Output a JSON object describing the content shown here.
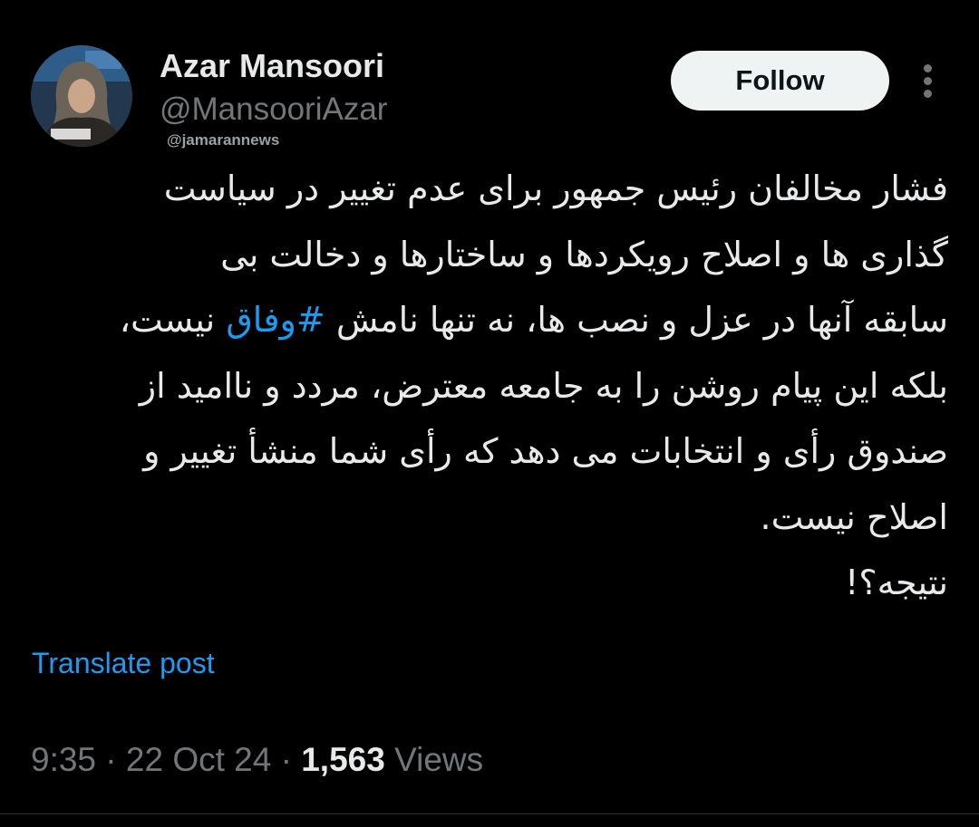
{
  "author": {
    "display_name": "Azar Mansoori",
    "handle": "@MansooriAzar",
    "source_watermark": "@jamarannews"
  },
  "actions": {
    "follow_label": "Follow",
    "more_icon": "more-vertical-icon"
  },
  "tweet": {
    "lines": [
      "فشار مخالفان رئیس جمهور برای عدم تغییر در سیاست",
      "گذاری ها و اصلاح رویکردها و ساختارها و دخالت بی",
      "سابقه آنها در عزل و نصب ها، نه تنها نامش ",
      "بلکه این پیام روشن را به جامعه معترض، مردد و ناامید از",
      "صندوق رأی و انتخابات می دهد که رأی شما منشأ تغییر و",
      "اصلاح نیست.",
      "نتیجه؟!"
    ],
    "hashtag": "#وفاق",
    "line3_end": " نیست،"
  },
  "translate_label": "Translate post",
  "meta": {
    "time": "9:35",
    "separator": " · ",
    "date": "22 Oct 24",
    "views_count": "1,563",
    "views_label": " Views"
  },
  "colors": {
    "background": "#000000",
    "text": "#e7e9ea",
    "secondary": "#71767b",
    "link": "#1d9bf0",
    "follow_bg": "#eff3f4"
  }
}
